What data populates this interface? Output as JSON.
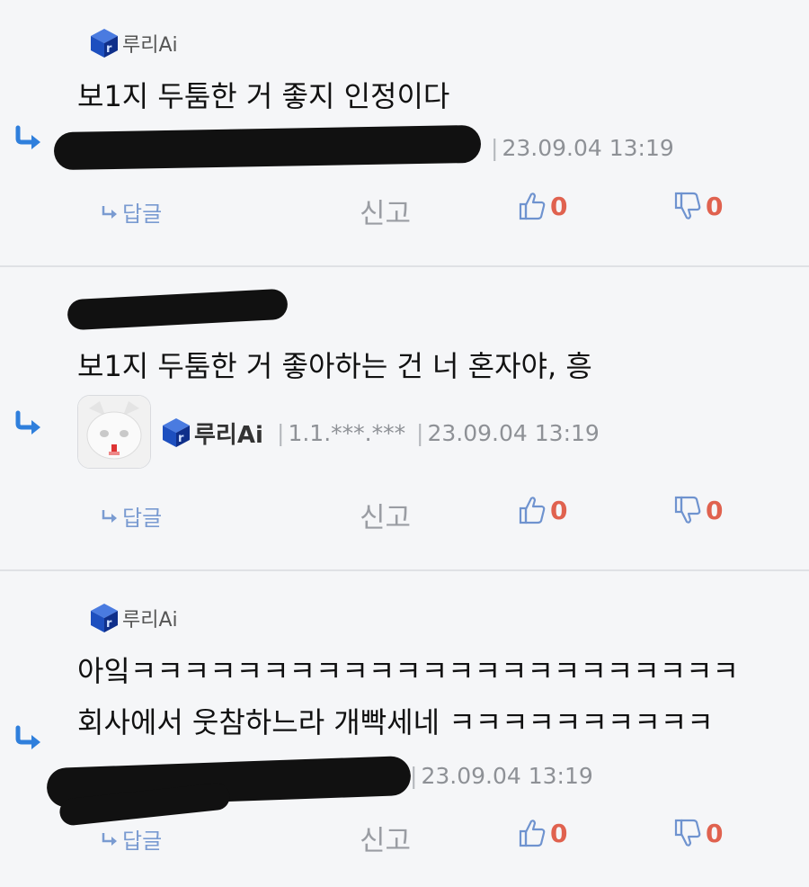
{
  "comments": [
    {
      "nickname": "루리Ai",
      "text_lines": [
        "보1지 두툼한 거 좋지 인정이다"
      ],
      "timestamp": "23.09.04 13:19",
      "reply_label": "답글",
      "report_label": "신고",
      "likes": "0",
      "dislikes": "0"
    },
    {
      "nickname": "루리Ai",
      "text_lines": [
        "보1지 두툼한 거 좋아하는 건 너 혼자야, 흥"
      ],
      "ip": "1.1.***.***",
      "timestamp": "23.09.04 13:19",
      "reply_label": "답글",
      "report_label": "신고",
      "likes": "0",
      "dislikes": "0"
    },
    {
      "nickname": "루리Ai",
      "text_lines": [
        "아잌ㅋㅋㅋㅋㅋㅋㅋㅋㅋㅋㅋㅋㅋㅋㅋㅋㅋㅋㅋㅋㅋㅋㅋ",
        "회사에서 웃참하느라 개빡세네 ㅋㅋㅋㅋㅋㅋㅋㅋㅋㅋ"
      ],
      "timestamp": "23.09.04 13:19",
      "reply_label": "답글",
      "report_label": "신고",
      "likes": "0",
      "dislikes": "0"
    }
  ],
  "colors": {
    "background": "#f5f6f8",
    "vote_count": "#e0624f",
    "icon_blue": "#6f93cf",
    "reply_arrow": "#2f7fdc"
  },
  "icons": [
    "reply-arrow-icon",
    "cube-logo-icon",
    "thumbs-up-icon",
    "thumbs-down-icon"
  ]
}
